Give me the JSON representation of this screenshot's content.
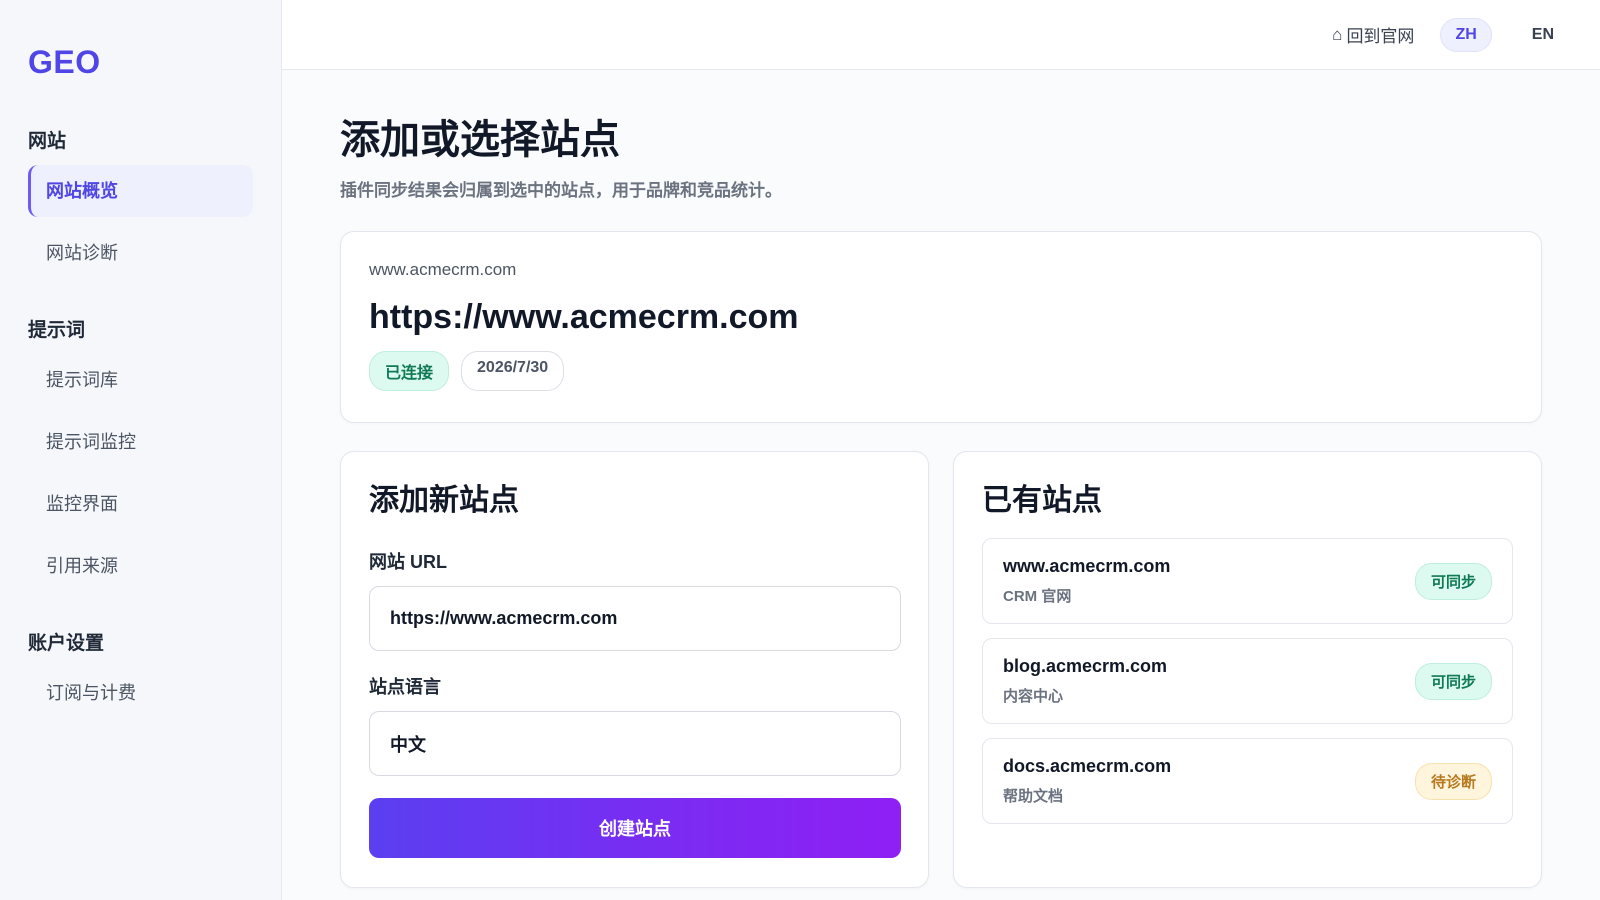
{
  "sidebar": {
    "logo": "GEO",
    "sections": [
      {
        "title": "网站",
        "items": [
          "网站概览",
          "网站诊断"
        ]
      },
      {
        "title": "提示词",
        "items": [
          "提示词库",
          "提示词监控",
          "监控界面",
          "引用来源"
        ]
      },
      {
        "title": "账户设置",
        "items": [
          "订阅与计费"
        ]
      }
    ],
    "active_item": "网站概览"
  },
  "topbar": {
    "home_icon": "⌂",
    "home_label": "回到官网",
    "lang_zh": "ZH",
    "lang_en": "EN",
    "active_lang": "ZH"
  },
  "page": {
    "title": "添加或选择站点",
    "subtitle": "插件同步结果会归属到选中的站点，用于品牌和竞品统计。"
  },
  "current_site": {
    "host": "www.acmecrm.com",
    "url": "https://www.acmecrm.com",
    "status": "已连接",
    "date": "2026/7/30"
  },
  "add_site": {
    "title": "添加新站点",
    "url_label": "网站 URL",
    "url_value": "https://www.acmecrm.com",
    "lang_label": "站点语言",
    "lang_value": "中文",
    "submit_label": "创建站点"
  },
  "existing_sites": {
    "title": "已有站点",
    "items": [
      {
        "host": "www.acmecrm.com",
        "desc": "CRM 官网",
        "badge": "可同步",
        "badge_type": "sync"
      },
      {
        "host": "blog.acmecrm.com",
        "desc": "内容中心",
        "badge": "可同步",
        "badge_type": "sync"
      },
      {
        "host": "docs.acmecrm.com",
        "desc": "帮助文档",
        "badge": "待诊断",
        "badge_type": "pending"
      }
    ]
  },
  "colors": {
    "accent": "#4f46e5",
    "success_bg": "#dcfaef",
    "success_text": "#0f7a55",
    "warning_bg": "#fff5dd",
    "warning_text": "#b7791f"
  }
}
